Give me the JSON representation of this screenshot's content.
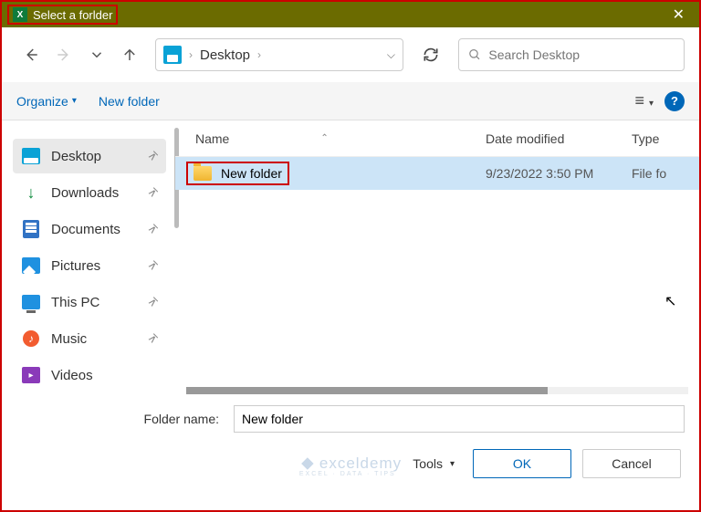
{
  "title": "Select a forlder",
  "address": {
    "location": "Desktop"
  },
  "search": {
    "placeholder": "Search Desktop"
  },
  "toolbar": {
    "organize": "Organize",
    "new_folder": "New folder"
  },
  "columns": {
    "name": "Name",
    "date": "Date modified",
    "type": "Type"
  },
  "sidebar": {
    "items": [
      {
        "label": "Desktop"
      },
      {
        "label": "Downloads"
      },
      {
        "label": "Documents"
      },
      {
        "label": "Pictures"
      },
      {
        "label": "This PC"
      },
      {
        "label": "Music"
      },
      {
        "label": "Videos"
      }
    ]
  },
  "files": [
    {
      "name": "New folder",
      "date": "9/23/2022 3:50 PM",
      "type": "File fo"
    }
  ],
  "footer": {
    "label": "Folder name:",
    "value": "New folder",
    "tools": "Tools",
    "ok": "OK",
    "cancel": "Cancel"
  },
  "watermark": {
    "main": "exceldemy",
    "sub": "EXCEL · DATA · TIPS"
  }
}
